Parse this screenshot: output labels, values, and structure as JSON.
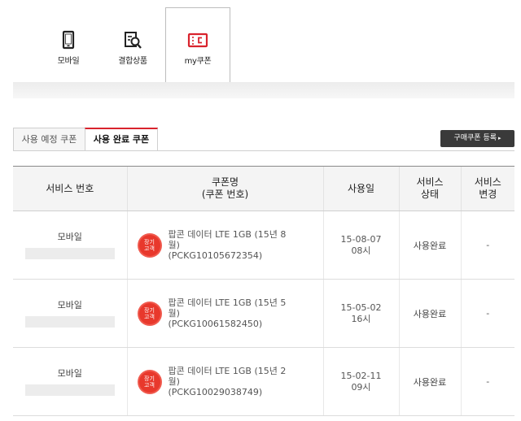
{
  "nav": {
    "items": [
      {
        "label": "모바일",
        "icon": "mobile-phone-icon"
      },
      {
        "label": "결합상품",
        "icon": "bundle-search-icon"
      },
      {
        "label": "my쿠폰",
        "icon": "coupon-icon",
        "active": true
      }
    ]
  },
  "tabs": [
    {
      "label": "사용 예정 쿠폰",
      "active": false
    },
    {
      "label": "사용 완료 쿠폰",
      "active": true
    }
  ],
  "register_button": {
    "label": "구매쿠폰 등록",
    "arrow": "▸"
  },
  "table": {
    "headers": {
      "service_no": "서비스 번호",
      "coupon_name": "쿠폰명",
      "coupon_no": "(쿠폰 번호)",
      "used_date": "사용일",
      "status_l1": "서비스",
      "status_l2": "상태",
      "change_l1": "서비스",
      "change_l2": "변경"
    },
    "rows": [
      {
        "service": "모바일",
        "badge_l1": "장기",
        "badge_l2": "고객",
        "coupon_l1": "팝콘 데이터 LTE 1GB (15년 8",
        "coupon_l2": "월)",
        "coupon_l3": "(PCKG10105672354)",
        "date": "15-08-07",
        "time": "08시",
        "status": "사용완료",
        "change": "-"
      },
      {
        "service": "모바일",
        "badge_l1": "장기",
        "badge_l2": "고객",
        "coupon_l1": "팝콘 데이터 LTE 1GB (15년 5",
        "coupon_l2": "월)",
        "coupon_l3": "(PCKG10061582450)",
        "date": "15-05-02",
        "time": "16시",
        "status": "사용완료",
        "change": "-"
      },
      {
        "service": "모바일",
        "badge_l1": "장기",
        "badge_l2": "고객",
        "coupon_l1": "팝콘 데이터 LTE 1GB (15년 2",
        "coupon_l2": "월)",
        "coupon_l3": "(PCKG10029038749)",
        "date": "15-02-11",
        "time": "09시",
        "status": "사용완료",
        "change": "-"
      }
    ]
  },
  "colors": {
    "accent": "#d9232d",
    "badge": "#e8382c",
    "button_dark": "#3a3a3a"
  }
}
